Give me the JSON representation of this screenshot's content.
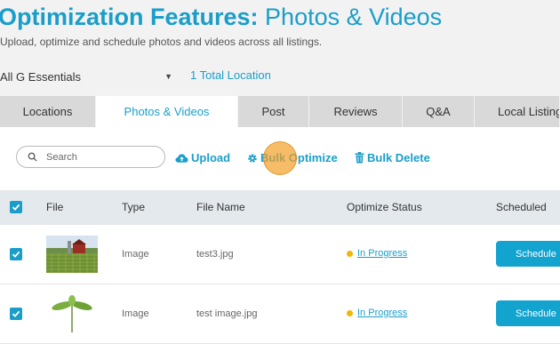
{
  "header": {
    "title_bold": "Optimization Features:",
    "title_light": "Photos & Videos",
    "subtitle": "Upload, optimize and schedule photos and videos across all listings."
  },
  "location": {
    "selected": "All G Essentials",
    "total": "1 Total Location"
  },
  "tabs": [
    {
      "label": "Locations",
      "active": false
    },
    {
      "label": "Photos & Videos",
      "active": true
    },
    {
      "label": "Post",
      "active": false
    },
    {
      "label": "Reviews",
      "active": false
    },
    {
      "label": "Q&A",
      "active": false
    },
    {
      "label": "Local Listings",
      "active": false
    }
  ],
  "toolbar": {
    "search_placeholder": "Search",
    "upload_label": "Upload",
    "bulk_optimize_label": "Bulk Optimize",
    "bulk_delete_label": "Bulk Delete"
  },
  "table": {
    "columns": [
      "File",
      "Type",
      "File Name",
      "Optimize Status",
      "Scheduled"
    ],
    "rows": [
      {
        "checked": true,
        "type": "Image",
        "file_name": "test3.jpg",
        "status": "In Progress",
        "action": "Schedule"
      },
      {
        "checked": true,
        "type": "Image",
        "file_name": "test image.jpg",
        "status": "In Progress",
        "action": "Schedule"
      }
    ]
  },
  "colors": {
    "accent": "#1a9ec9",
    "status_pending": "#f2b705",
    "button": "#12a3cf"
  }
}
